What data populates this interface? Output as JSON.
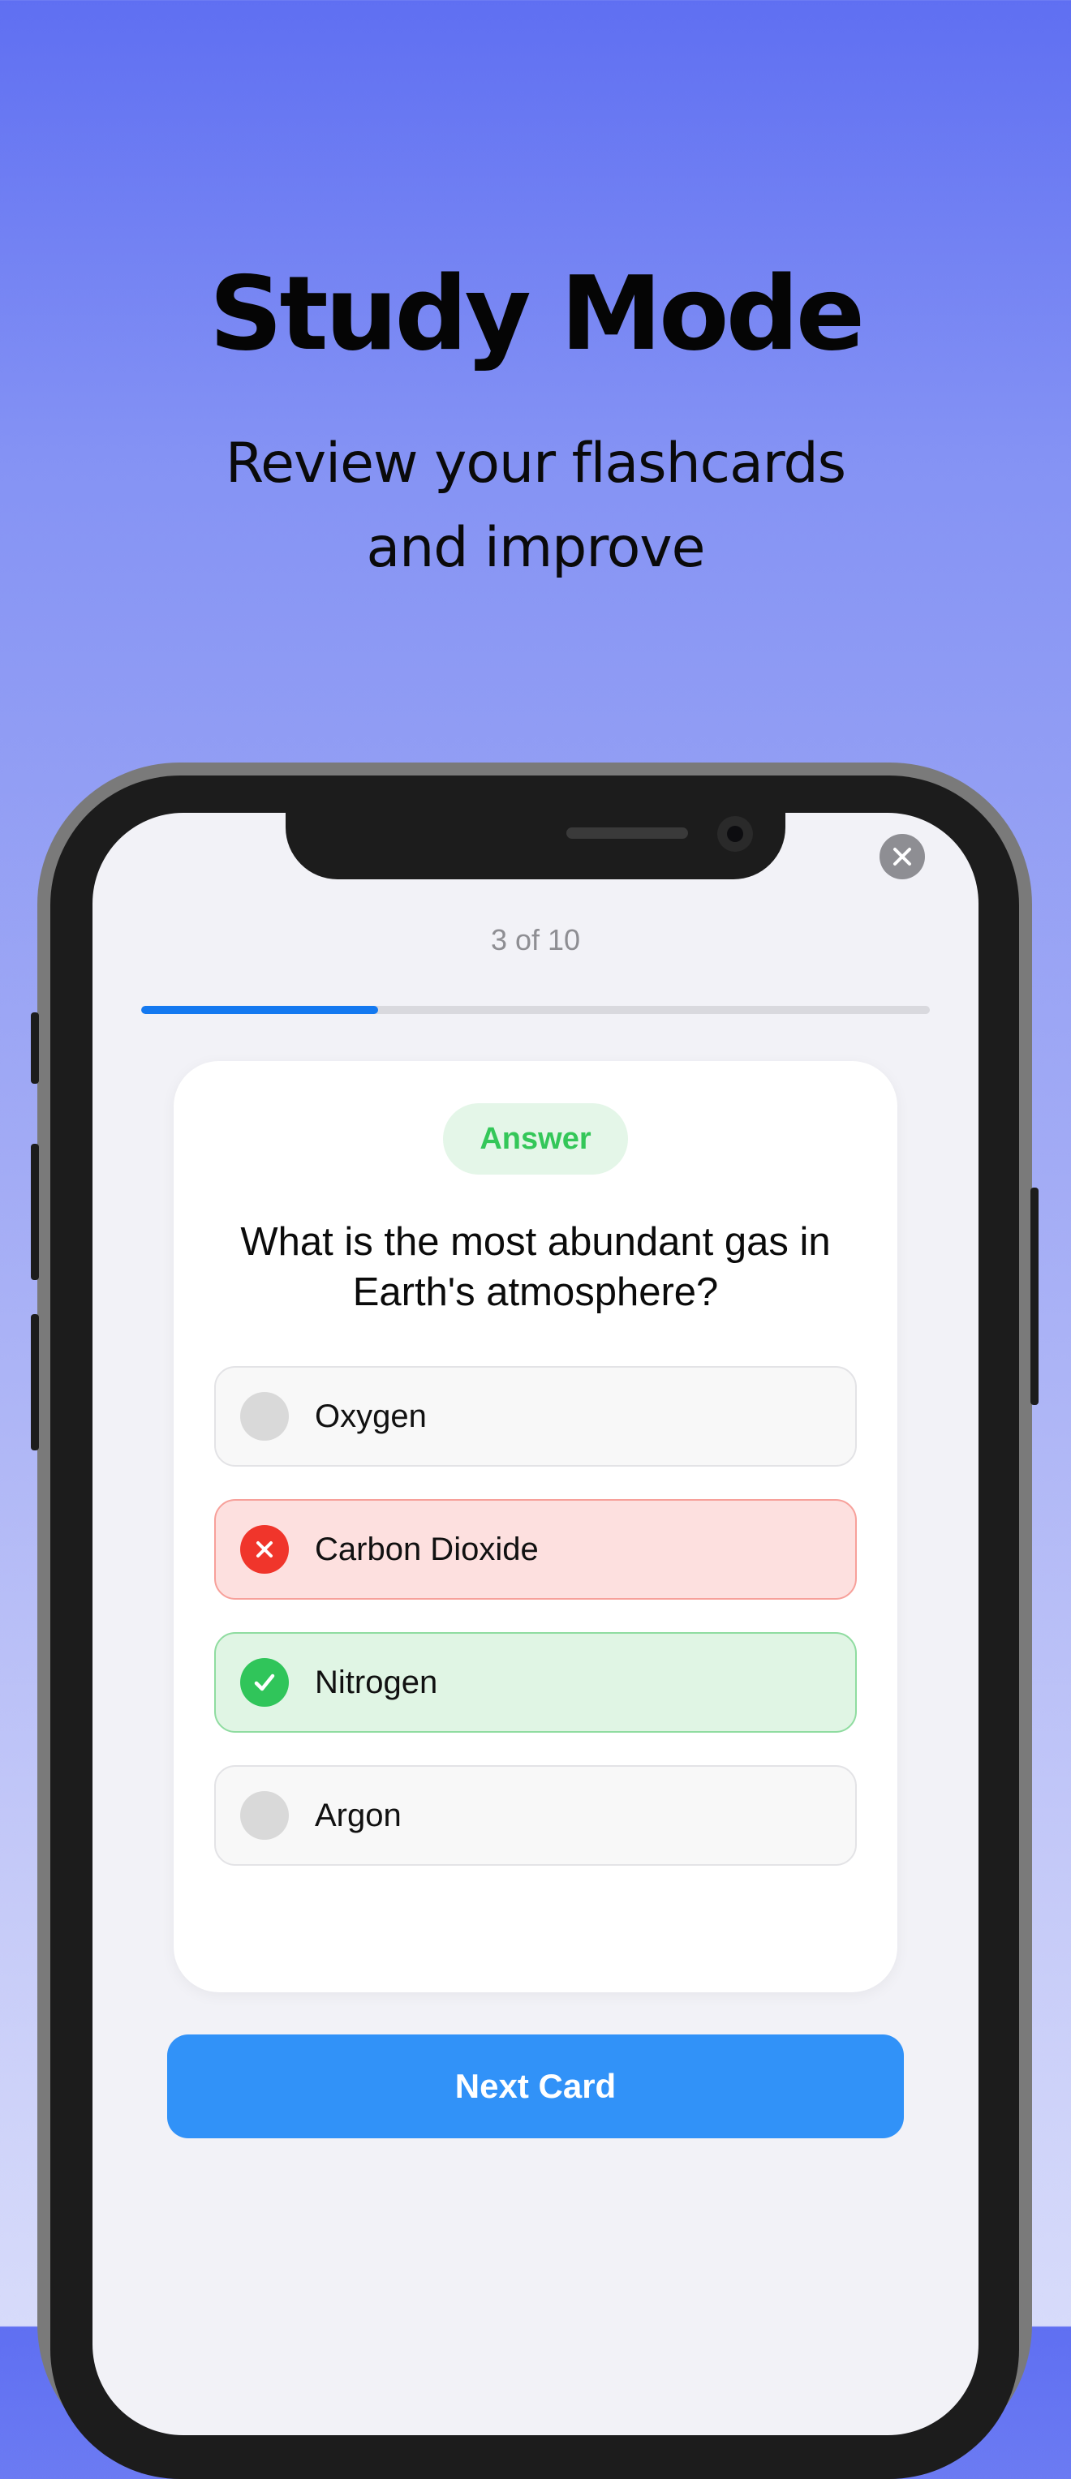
{
  "promo": {
    "title": "Study Mode",
    "subtitle": "Review your flashcards and improve"
  },
  "study": {
    "progress_text": "3 of 10",
    "progress_fraction": 0.3,
    "badge": "Answer",
    "question": "What is the most abundant gas in Earth's atmosphere?",
    "options": [
      {
        "label": "Oxygen",
        "state": "neutral"
      },
      {
        "label": "Carbon Dioxide",
        "state": "incorrect"
      },
      {
        "label": "Nitrogen",
        "state": "correct"
      },
      {
        "label": "Argon",
        "state": "neutral"
      }
    ],
    "next_label": "Next Card"
  },
  "icons": {
    "close": "close-icon",
    "incorrect": "x-mark-icon",
    "correct": "checkmark-icon"
  },
  "colors": {
    "accent": "#3192f8",
    "progress": "#1479f0",
    "correct": "#30c55a",
    "incorrect": "#f0352b"
  }
}
